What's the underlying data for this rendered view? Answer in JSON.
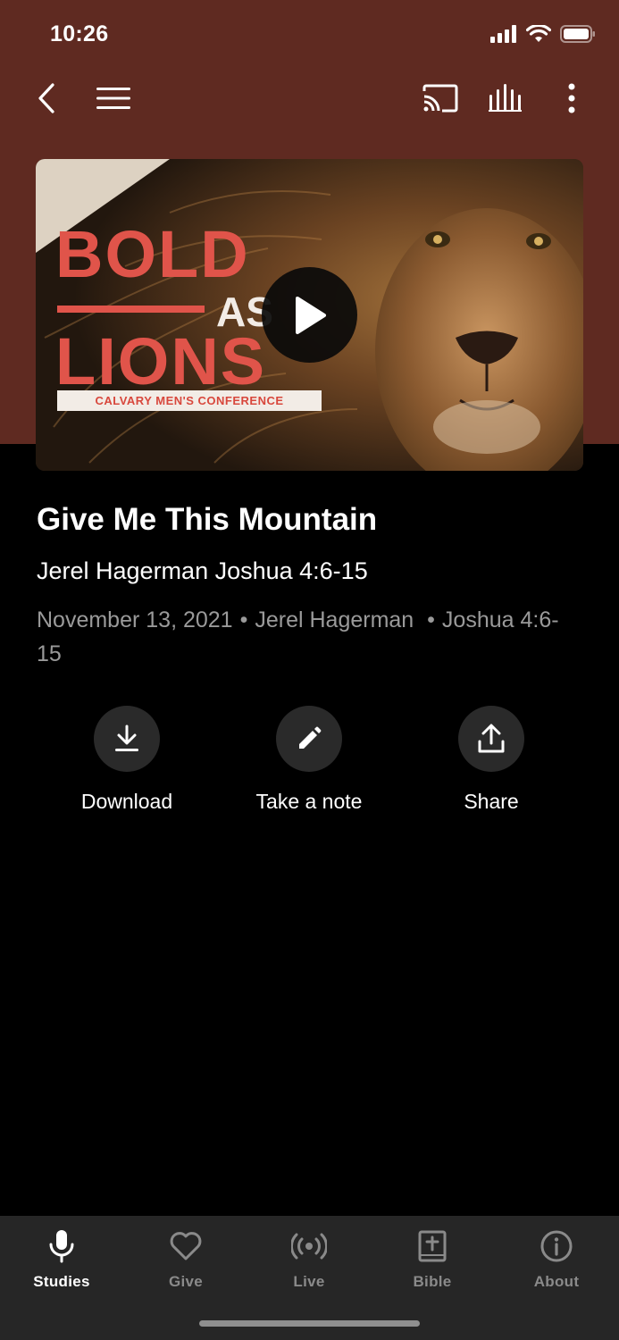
{
  "status": {
    "time": "10:26"
  },
  "episode": {
    "title": "Give Me This Mountain",
    "subtitle": "Jerel Hagerman Joshua 4:6-15",
    "date": "November 13, 2021",
    "speaker": "Jerel Hagerman",
    "passage": "Joshua 4:6-15"
  },
  "artwork": {
    "line1": "BOLD",
    "line2": "AS",
    "line3": "LIONS",
    "tagline": "CALVARY MEN'S CONFERENCE"
  },
  "actions": [
    {
      "label": "Download",
      "icon": "download-icon"
    },
    {
      "label": "Take a note",
      "icon": "pencil-icon"
    },
    {
      "label": "Share",
      "icon": "share-icon"
    }
  ],
  "tabs": [
    {
      "label": "Studies",
      "icon": "microphone-icon",
      "active": true
    },
    {
      "label": "Give",
      "icon": "heart-icon",
      "active": false
    },
    {
      "label": "Live",
      "icon": "broadcast-icon",
      "active": false
    },
    {
      "label": "Bible",
      "icon": "bible-icon",
      "active": false
    },
    {
      "label": "About",
      "icon": "info-icon",
      "active": false
    }
  ],
  "colors": {
    "header": "#5f2a21",
    "accent_red": "#e0544a"
  }
}
